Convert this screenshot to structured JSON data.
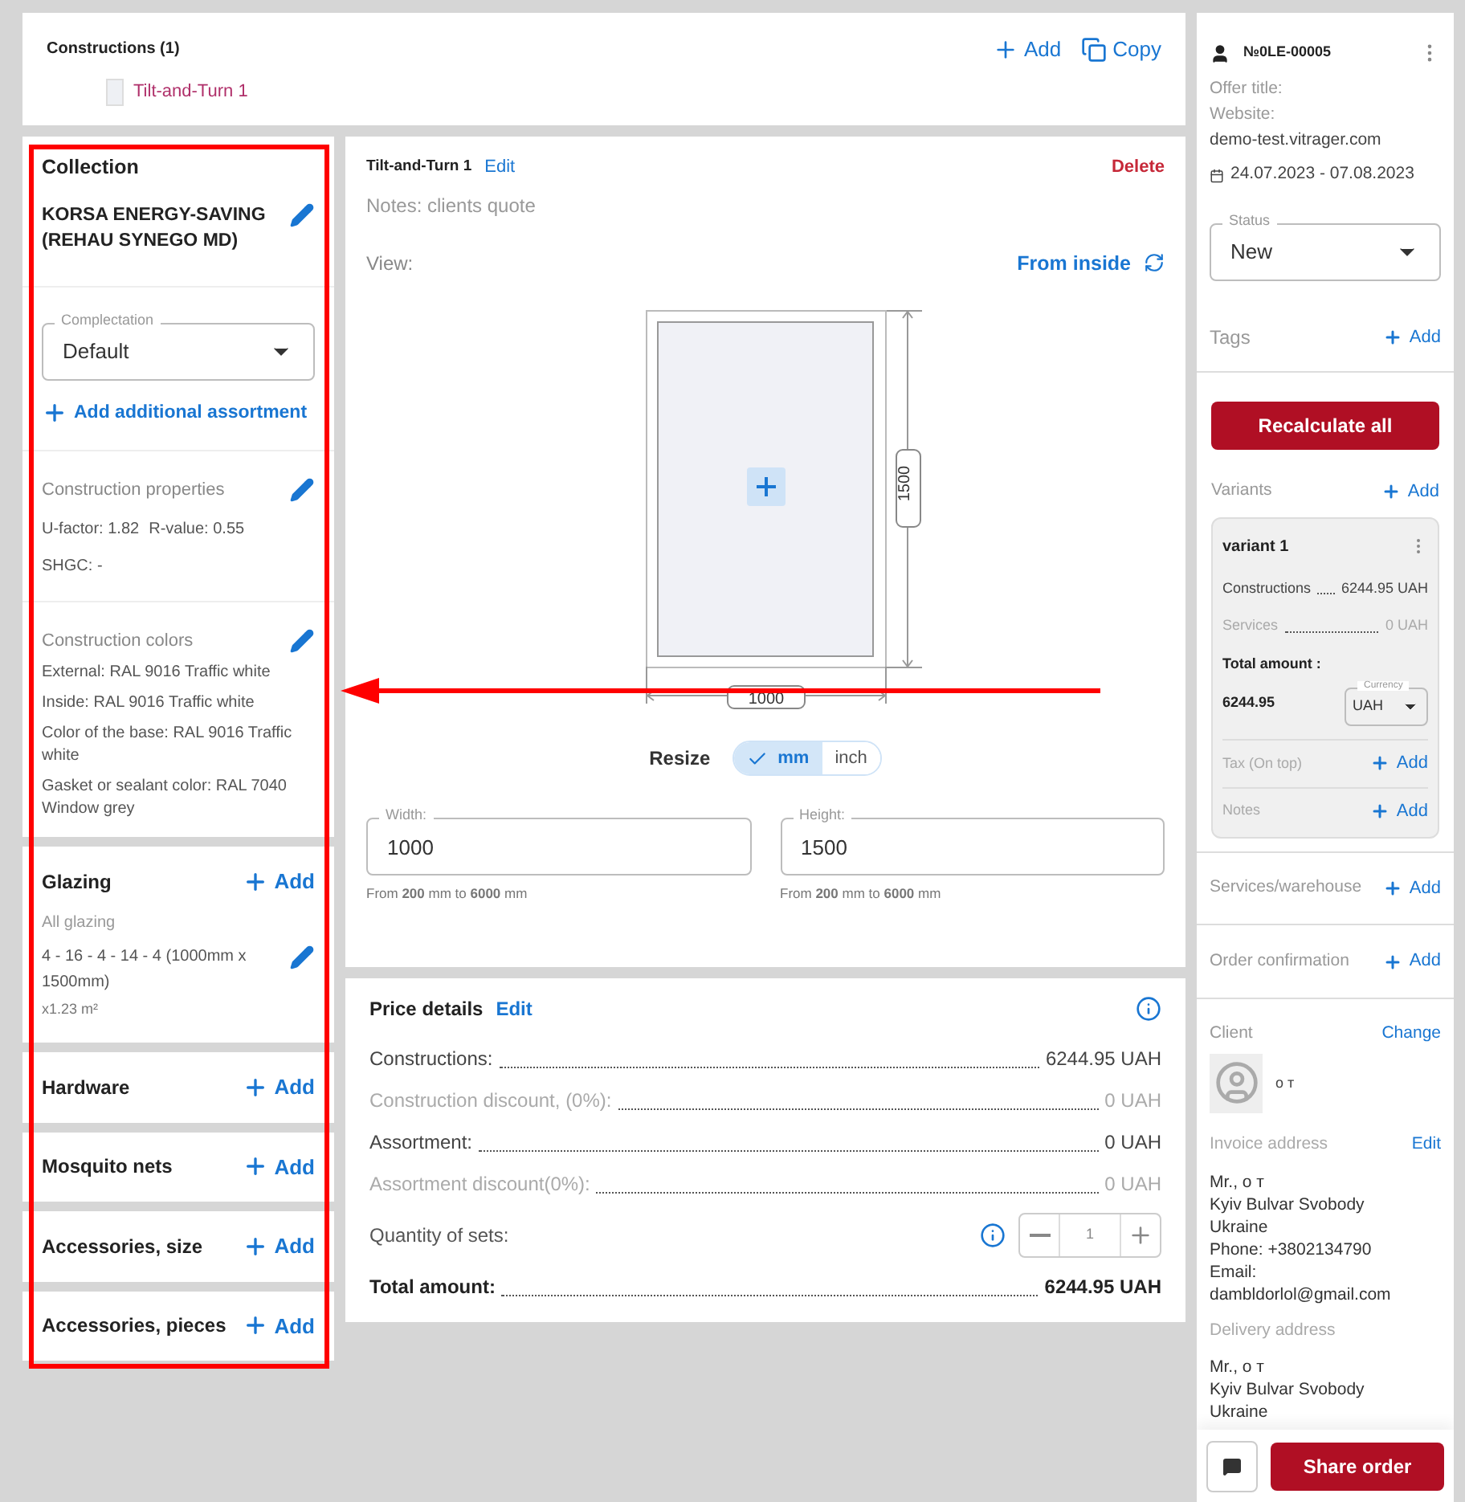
{
  "constructions": {
    "title": "Constructions (1)",
    "add": "Add",
    "copy": "Copy",
    "items": [
      {
        "label": "Tilt-and-Turn 1",
        "selected": true
      }
    ]
  },
  "collection": {
    "heading": "Collection",
    "name": "KORSA ENERGY-SAVING (REHAU SYNEGO MD)",
    "complectation": {
      "label": "Complectation",
      "value": "Default"
    },
    "add_assortment": "Add additional assortment",
    "properties": {
      "title": "Construction properties",
      "lines": [
        [
          "U-factor: 1.82",
          "R-value: 0.55"
        ],
        [
          "SHGC: -"
        ]
      ]
    },
    "colors": {
      "title": "Construction colors",
      "lines": [
        "External: RAL 9016 Traffic white",
        "Inside: RAL 9016 Traffic white",
        "Color of the base: RAL 9016 Traffic white",
        "Gasket or sealant color: RAL 7040 Window grey"
      ]
    }
  },
  "sections": [
    {
      "title": "Glazing",
      "add": "Add",
      "details": {
        "subtitle": "All glazing",
        "text": "4 - 16 - 4 - 14 - 4 (1000mm x 1500mm)",
        "area": "x1.23 m²"
      }
    },
    {
      "title": "Hardware",
      "add": "Add"
    },
    {
      "title": "Mosquito nets",
      "add": "Add"
    },
    {
      "title": "Accessories, size",
      "add": "Add"
    },
    {
      "title": "Accessories, pieces",
      "add": "Add"
    }
  ],
  "construction": {
    "name": "Tilt-and-Turn 1",
    "edit": "Edit",
    "delete": "Delete",
    "notes": "Notes: clients quote",
    "view_label": "View:",
    "view_value": "From inside",
    "width_dim": "1000",
    "height_dim": "1500",
    "resize": {
      "label": "Resize",
      "units": [
        {
          "label": "mm",
          "selected": true
        },
        {
          "label": "inch",
          "selected": false
        }
      ]
    },
    "fields": [
      {
        "label": "Width:",
        "value": "1000",
        "hint": "From **200** mm to **6000** mm"
      },
      {
        "label": "Height:",
        "value": "1500",
        "hint": "From **200** mm to **6000** mm"
      }
    ]
  },
  "price": {
    "title": "Price details",
    "edit": "Edit",
    "rows": [
      {
        "label": "Constructions:",
        "value": "6244.95 UAH",
        "muted": false
      },
      {
        "label": "Construction discount, (0%):",
        "value": "0 UAH",
        "muted": true
      },
      {
        "label": "Assortment:",
        "value": "0 UAH",
        "muted": false
      },
      {
        "label": "Assortment discount(0%):",
        "value": "0 UAH",
        "muted": true
      }
    ],
    "quantity": {
      "label": "Quantity of sets:",
      "value": "1"
    },
    "total": {
      "label": "Total amount:",
      "value": "6244.95 UAH"
    }
  },
  "order": {
    "number": "№0LE-00005",
    "offer_title": "Offer title:",
    "website_label": "Website:",
    "website": "demo-test.vitrager.com",
    "dates": "24.07.2023 - 07.08.2023",
    "status": {
      "label": "Status",
      "value": "New"
    },
    "tags": "Tags",
    "tags_add": "Add",
    "recalc": "Recalculate all",
    "variants_title": "Variants",
    "variants_add": "Add",
    "variants": [
      {
        "name": "variant 1",
        "rows": [
          {
            "label": "Constructions",
            "value": "6244.95 UAH",
            "muted": false
          },
          {
            "label": "Services",
            "value": "0 UAH",
            "muted": true
          }
        ],
        "total_label": "Total amount :",
        "total": "6244.95",
        "currency": {
          "label": "Currency",
          "value": "UAH"
        },
        "tax": "Tax (On top)",
        "tax_add": "Add",
        "notes": "Notes",
        "notes_add": "Add"
      }
    ],
    "services": "Services/warehouse",
    "services_add": "Add",
    "confirmation": "Order confirmation",
    "confirmation_add": "Add",
    "client": {
      "title": "Client",
      "change": "Change",
      "name": "о т"
    },
    "invoice": {
      "title": "Invoice address",
      "edit": "Edit",
      "lines": [
        "Mr., о т",
        "Kyiv Bulvar Svobody",
        "Ukraine",
        "Phone: +3802134790",
        "Email: dambldorlol@gmail.com"
      ]
    },
    "delivery": {
      "title": "Delivery address",
      "lines": [
        "Mr., о т",
        "Kyiv Bulvar Svobody",
        "Ukraine"
      ]
    },
    "share": "Share order"
  }
}
